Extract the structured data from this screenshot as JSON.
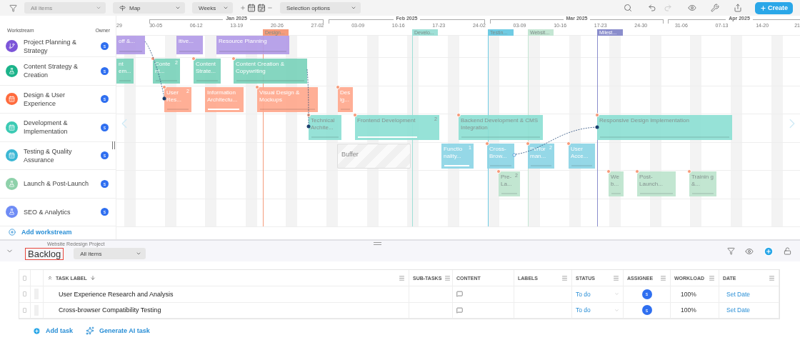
{
  "toolbar": {
    "filter_dropdown": {
      "value": "All items",
      "disabled": true
    },
    "view_dropdown": "Map",
    "scale_dropdown": "Weeks",
    "selection_dropdown": "Selection options",
    "create_button": "Create"
  },
  "sidebar": {
    "workstream_header": "Workstream",
    "owner_header": "Owner",
    "add_button": "Add workstream"
  },
  "timeline": {
    "months": [
      "Jan 2025",
      "Feb 2025",
      "Mar 2025",
      "Apr 2025"
    ],
    "weeks": [
      "29",
      "30-05",
      "06-12",
      "13-19",
      "20-26",
      "27-02",
      "03-09",
      "10-16",
      "17-23",
      "24-02",
      "03-09",
      "10-16",
      "17-23",
      "24-30",
      "31-06",
      "07-13",
      "14-20",
      "21"
    ],
    "milestones": [
      {
        "label": "Design...",
        "color": "#f59c7c"
      },
      {
        "label": "Develo...",
        "color": "#9fe0d7"
      },
      {
        "label": "Testin...",
        "color": "#6fcbe3"
      },
      {
        "label": "Websit...",
        "color": "#c4e6d3"
      },
      {
        "label": "Milest...",
        "color": "#8a8dcc"
      }
    ]
  },
  "workstreams": [
    {
      "name": "Project Planning & Strategy",
      "color": "#7c55d8",
      "owner": "s",
      "bars": [
        {
          "kind": "task",
          "label": "off &...",
          "alert": false
        },
        {
          "kind": "task",
          "label": "itive...",
          "alert": false
        },
        {
          "kind": "task",
          "label": "Resource Planning",
          "alert": false
        }
      ]
    },
    {
      "name": "Content Strategy & Creation",
      "color": "#1bb38a",
      "owner": "s",
      "bars": [
        {
          "kind": "task",
          "label": "nt em...",
          "alert": false
        },
        {
          "kind": "task",
          "label": "Conte nt...",
          "badge": "2",
          "alert": true
        },
        {
          "kind": "task",
          "label": "Content Strate...",
          "alert": true
        },
        {
          "kind": "task",
          "label": "Content Creation & Copywriting",
          "alert": true
        }
      ]
    },
    {
      "name": "Design & User Experience",
      "color": "#ff6b3d",
      "owner": "s",
      "bars": [
        {
          "kind": "task",
          "label": "User Res...",
          "badge": "2",
          "alert": true
        },
        {
          "kind": "task",
          "label": "Information Architectu...",
          "alert": false,
          "level": 0.95
        },
        {
          "kind": "task",
          "label": "Visual Design & Mockups",
          "alert": true
        },
        {
          "kind": "task",
          "label": "Des ig...",
          "alert": true
        }
      ]
    },
    {
      "name": "Development & Implementation",
      "color": "#3ccab4",
      "owner": "s",
      "bars": [
        {
          "kind": "task",
          "label": "Technical Archite...",
          "alert": true
        },
        {
          "kind": "task",
          "label": "Frontend Development",
          "badge": "2",
          "alert": true,
          "level": 0.75
        },
        {
          "kind": "task",
          "label": "Backend Development & CMS Integration",
          "alert": true
        },
        {
          "kind": "task",
          "label": "Responsive Design Implementation",
          "alert": true
        }
      ]
    },
    {
      "name": "Testing & Quality Assurance",
      "color": "#3bb7d4",
      "owner": "s",
      "bars": [
        {
          "kind": "buffer",
          "label": "Buffer"
        },
        {
          "kind": "task",
          "label": "Functio nality...",
          "badge": "1",
          "alert": false,
          "level": 0.95
        },
        {
          "kind": "task",
          "label": "Cross-Brow...",
          "alert": true
        },
        {
          "kind": "task",
          "label": "Perfor man...",
          "badge": "2",
          "alert": true
        },
        {
          "kind": "task",
          "label": "User Acce...",
          "alert": true
        }
      ]
    },
    {
      "name": "Launch & Post-Launch",
      "color": "#8ed1aa",
      "owner": "s",
      "bars": [
        {
          "kind": "task",
          "label": "Pre-La...",
          "badge": "2",
          "alert": true
        },
        {
          "kind": "task",
          "label": "We b...",
          "alert": true
        },
        {
          "kind": "task",
          "label": "Post-Launch...",
          "alert": true
        },
        {
          "kind": "task",
          "label": "Trainin g &...",
          "alert": true
        }
      ]
    },
    {
      "name": "SEO & Analytics",
      "color": "#6f8cf5",
      "owner": "s"
    }
  ],
  "backlog": {
    "project": "Website Redesign Project",
    "title": "Backlog",
    "filter": "All items",
    "select_all": {
      "checked": false
    },
    "columns": [
      "TASK LABEL",
      "SUB-TASKS",
      "CONTENT",
      "LABELS",
      "STATUS",
      "ASSIGNEE",
      "WORKLOAD",
      "DATE"
    ],
    "rows": [
      {
        "checked": false,
        "label": "User Experience Research and Analysis",
        "status": "To do",
        "assignee": "s",
        "workload": "100%",
        "date": "Set Date"
      },
      {
        "checked": false,
        "label": "Cross-browser Compatibility Testing",
        "status": "To do",
        "assignee": "s",
        "workload": "100%",
        "date": "Set Date"
      }
    ],
    "add_task": "Add task",
    "ai_task": "Generate AI task"
  }
}
